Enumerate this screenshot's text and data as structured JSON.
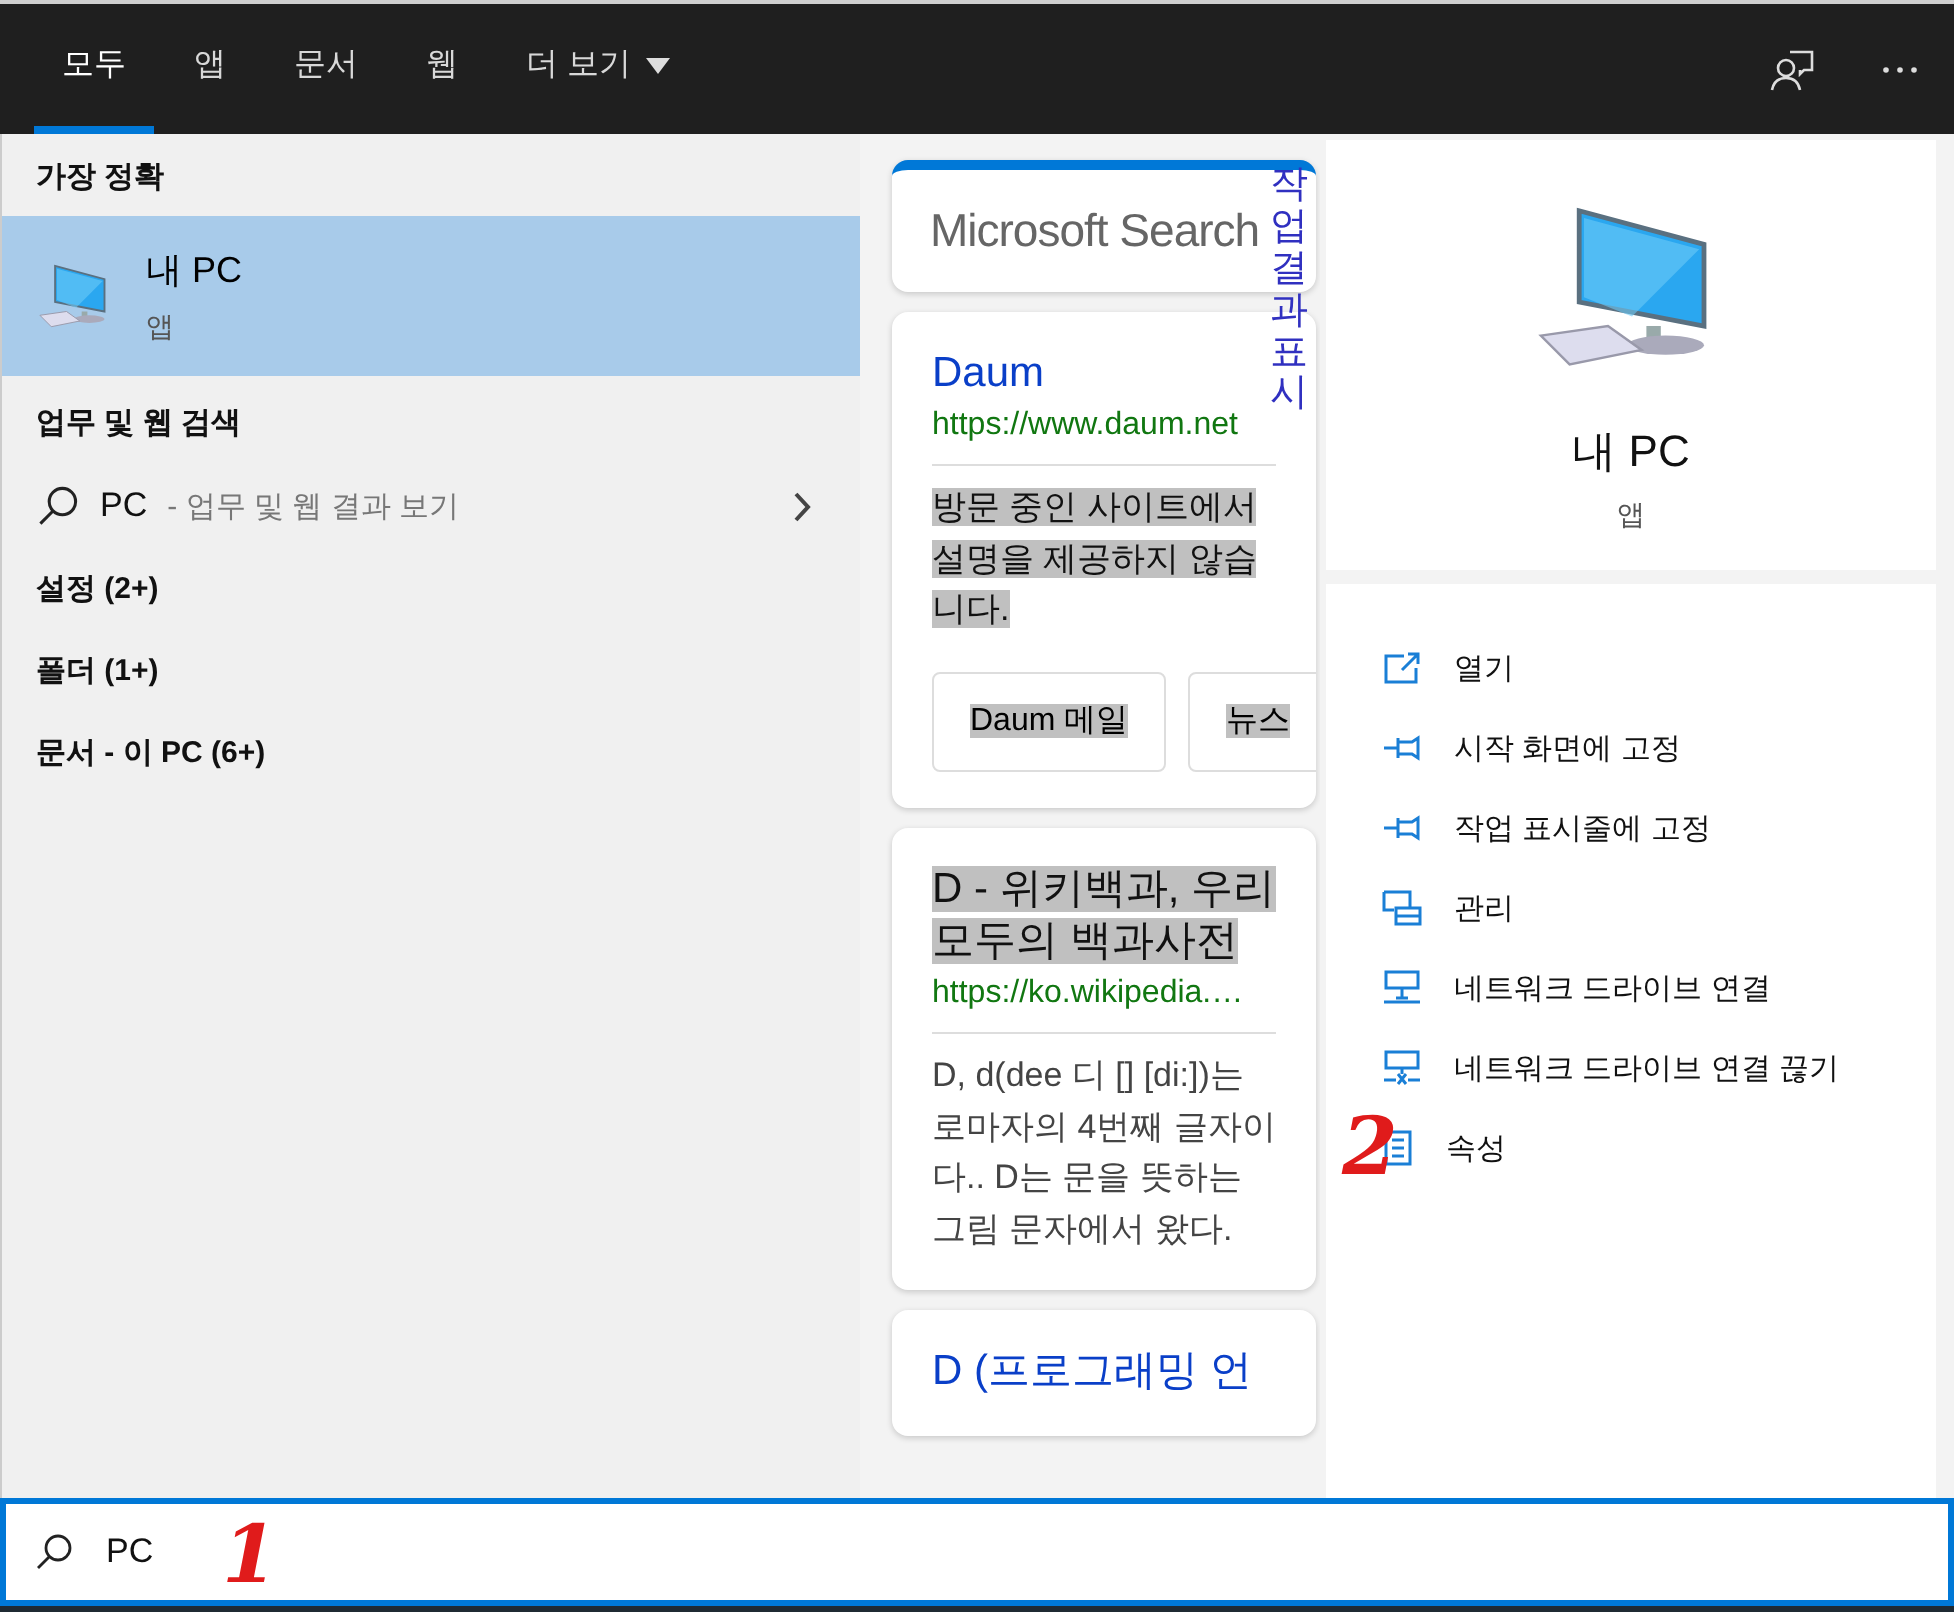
{
  "tabs": [
    {
      "label": "모두",
      "selected": true
    },
    {
      "label": "앱",
      "selected": false
    },
    {
      "label": "문서",
      "selected": false
    },
    {
      "label": "웹",
      "selected": false
    },
    {
      "label": "더 보기",
      "selected": false,
      "dropdown": true
    }
  ],
  "best_match": {
    "heading": "가장 정확",
    "title": "내 PC",
    "subtitle": "앱",
    "selected": true
  },
  "web_search": {
    "heading": "업무 및 웹 검색",
    "query": "PC",
    "hint": "- 업무 및 웹 결과 보기"
  },
  "categories": [
    "설정 (2+)",
    "폴더 (1+)",
    "문서 - 이 PC (6+)"
  ],
  "microsoft_search": {
    "logo": "Microsoft Search",
    "side_link": "작업 결과 표시"
  },
  "results": [
    {
      "title": "Daum",
      "title_highlighted": false,
      "url": "https://www.daum.net",
      "snippet": "방문 중인 사이트에서 설명을 제공하지 않습니다.",
      "snippet_highlighted": true,
      "links": [
        {
          "label": "Daum 메일",
          "highlighted": true
        },
        {
          "label": "뉴스",
          "highlighted": true
        }
      ]
    },
    {
      "title": "D - 위키백과, 우리 모두의 백과사전",
      "title_highlighted": true,
      "url": "https://ko.wikipedia.…",
      "snippet": "D, d(dee 디 [] [di:])는 로마자의 4번째 글자이다.. D는 문을 뜻하는 그림 문자에서 왔다.",
      "snippet_highlighted": false
    },
    {
      "title": "D (프로그래밍 언",
      "title_highlighted": false
    }
  ],
  "preview": {
    "title": "내 PC",
    "subtitle": "앱"
  },
  "actions": [
    {
      "label": "열기",
      "kind": "open"
    },
    {
      "label": "시작 화면에 고정",
      "kind": "pin"
    },
    {
      "label": "작업 표시줄에 고정",
      "kind": "pin"
    },
    {
      "label": "관리",
      "kind": "manage"
    },
    {
      "label": "네트워크 드라이브 연결",
      "kind": "network"
    },
    {
      "label": "네트워크 드라이브 연결 끊기",
      "kind": "disconnect"
    },
    {
      "label": "속성",
      "kind": "properties"
    }
  ],
  "search": {
    "value": "PC"
  },
  "annotations": [
    {
      "text": "1"
    },
    {
      "text": "2"
    }
  ]
}
